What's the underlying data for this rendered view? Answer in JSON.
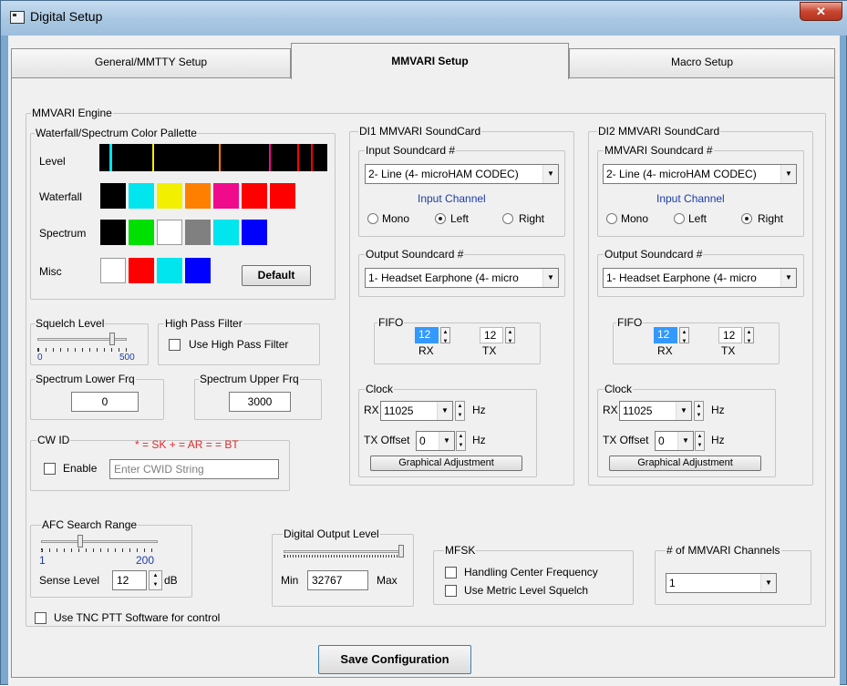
{
  "window": {
    "title": "Digital Setup",
    "close_icon": "✕"
  },
  "tabs": [
    "General/MMTTY Setup",
    "MMVARI Setup",
    "Macro Setup"
  ],
  "engine": {
    "title": "MMVARI Engine"
  },
  "palette": {
    "title": "Waterfall/Spectrum Color Pallette",
    "level_label": "Level",
    "waterfall_label": "Waterfall",
    "spectrum_label": "Spectrum",
    "misc_label": "Misc",
    "default_button": "Default",
    "waterfall_colors": [
      "#000000",
      "#00e5ee",
      "#f2f000",
      "#ff8000",
      "#f00a8c",
      "#ff0000",
      "#ff0000"
    ],
    "spectrum_colors": [
      "#000000",
      "#00e000",
      "#ffffff",
      "#808080",
      "#00e5ee",
      "#0000ff"
    ],
    "misc_colors": [
      "#ffffff",
      "#ff0000",
      "#00e5ee",
      "#0000ff"
    ]
  },
  "squelch": {
    "title": "Squelch Level",
    "min": "0",
    "max": "500"
  },
  "hpf": {
    "title": "High Pass Filter",
    "checkbox": "Use High Pass Filter"
  },
  "spec_lower": {
    "title": "Spectrum Lower Frq",
    "value": "0"
  },
  "spec_upper": {
    "title": "Spectrum Upper Frq",
    "value": "3000"
  },
  "cwid": {
    "title": "CW ID",
    "hint": "* = SK  + = AR  = = BT",
    "enable": "Enable",
    "placeholder": "Enter CWID String"
  },
  "afc": {
    "title": "AFC Search Range",
    "min": "1",
    "max": "200",
    "sense_label": "Sense Level",
    "sense_value": "12",
    "unit": "dB"
  },
  "tnc": {
    "label": "Use TNC PTT Software for control"
  },
  "di1": {
    "title": "DI1 MMVARI SoundCard",
    "input_title": "Input Soundcard #",
    "input_value": "2- Line (4- microHAM CODEC)",
    "channel_label": "Input Channel",
    "mono": "Mono",
    "left": "Left",
    "right": "Right",
    "output_title": "Output Soundcard #",
    "output_value": "1- Headset Earphone (4- micro",
    "fifo": {
      "title": "FIFO",
      "rx": "12",
      "tx": "12",
      "rx_label": "RX",
      "tx_label": "TX"
    },
    "clock": {
      "title": "Clock",
      "rx_label": "RX",
      "rx_value": "11025",
      "hz": "Hz",
      "offset_label": "TX Offset",
      "offset_value": "0",
      "adjust": "Graphical Adjustment"
    }
  },
  "di2": {
    "title": "DI2 MMVARI SoundCard",
    "input_title": "MMVARI Soundcard #",
    "input_value": "2- Line (4- microHAM CODEC)",
    "channel_label": "Input Channel",
    "mono": "Mono",
    "left": "Left",
    "right": "Right",
    "output_title": "Output Soundcard #",
    "output_value": "1- Headset Earphone (4- micro",
    "fifo": {
      "title": "FIFO",
      "rx": "12",
      "tx": "12",
      "rx_label": "RX",
      "tx_label": "TX"
    },
    "clock": {
      "title": "Clock",
      "rx_label": "RX",
      "rx_value": "11025",
      "hz": "Hz",
      "offset_label": "TX Offset",
      "offset_value": "0",
      "adjust": "Graphical Adjustment"
    }
  },
  "dol": {
    "title": "Digital Output Level",
    "min": "Min",
    "max": "Max",
    "value": "32767"
  },
  "mfsk": {
    "title": "MFSK",
    "handling": "Handling Center Frequency",
    "metric": "Use Metric Level Squelch"
  },
  "channels": {
    "title": "# of MMVARI Channels",
    "value": "1"
  },
  "save_button": "Save Configuration"
}
